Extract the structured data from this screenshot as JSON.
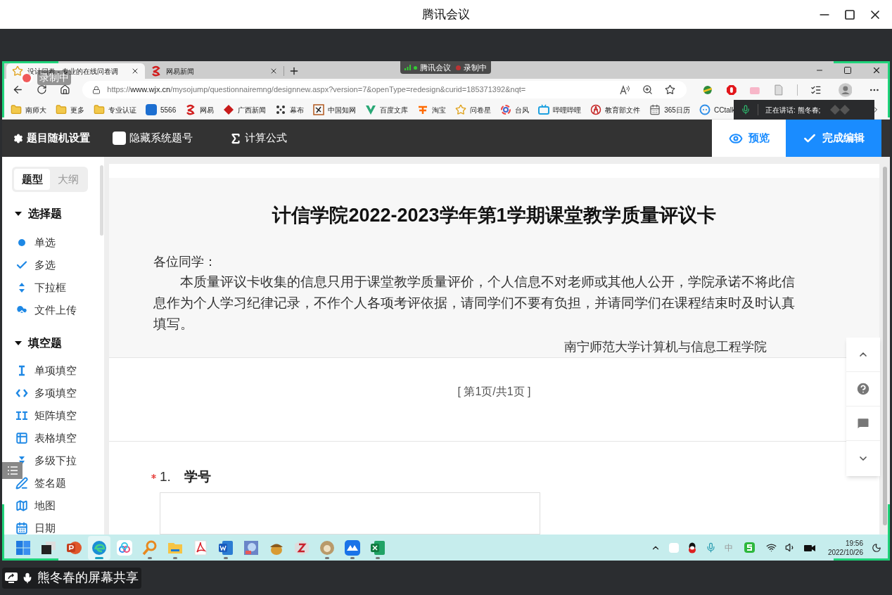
{
  "meeting": {
    "title": "腾讯会议",
    "pill_app": "腾讯会议",
    "pill_status": "录制中",
    "recording_badge": "录制中",
    "speaking": "正在讲话: 熊冬春;",
    "share_label": "熊冬春的屏幕共享"
  },
  "browser": {
    "tabs": [
      {
        "title": "设计问卷 - 专业的在线问卷调",
        "kind": "star",
        "selected": true
      },
      {
        "title": "网易新闻",
        "kind": "netease",
        "selected": false
      }
    ],
    "url_scheme": "https://",
    "url_host": "www.wjx.cn",
    "url_path": "/mysojump/questionnairemng/designnew.aspx?version=7&openType=redesign&curid=185371392&nqt=",
    "bookmarks": [
      {
        "label": "南师大",
        "kind": "folder"
      },
      {
        "label": "更多",
        "kind": "folder"
      },
      {
        "label": "专业认证",
        "kind": "folder"
      },
      {
        "label": "5566",
        "kind": "five"
      },
      {
        "label": "网易",
        "kind": "netease"
      },
      {
        "label": "广西新闻",
        "kind": "diamond"
      },
      {
        "label": "幕布",
        "kind": "dots"
      },
      {
        "label": "中国知网",
        "kind": "cnki"
      },
      {
        "label": "百度文库",
        "kind": "vee"
      },
      {
        "label": "淘宝",
        "kind": "taobao"
      },
      {
        "label": "问卷星",
        "kind": "star"
      },
      {
        "label": "台风",
        "kind": "swirl"
      },
      {
        "label": "哔哩哔哩",
        "kind": "tv"
      },
      {
        "label": "教育部文件",
        "kind": "emblem"
      },
      {
        "label": "365日历",
        "kind": "calendar"
      },
      {
        "label": "CCtalk",
        "kind": "cc"
      }
    ]
  },
  "toolbar": {
    "random": "题目随机设置",
    "hide_numbers": {
      "label": "隐藏系统题号",
      "checked": false
    },
    "formula": "计算公式",
    "preview": "预览",
    "done": "完成编辑"
  },
  "sidebar": {
    "tabs": [
      {
        "label": "题型",
        "selected": true
      },
      {
        "label": "大纲",
        "selected": false
      }
    ],
    "groups": [
      {
        "title": "选择题",
        "expanded": true,
        "items": [
          {
            "label": "单选",
            "kind": "radio"
          },
          {
            "label": "多选",
            "kind": "check"
          },
          {
            "label": "下拉框",
            "kind": "updown"
          },
          {
            "label": "文件上传",
            "kind": "upload"
          }
        ]
      },
      {
        "title": "填空题",
        "expanded": true,
        "items": [
          {
            "label": "单项填空",
            "kind": "cursor"
          },
          {
            "label": "多项填空",
            "kind": "braces"
          },
          {
            "label": "矩阵填空",
            "kind": "double-cursor"
          },
          {
            "label": "表格填空",
            "kind": "table"
          },
          {
            "label": "多级下拉",
            "kind": "cascade"
          },
          {
            "label": "签名题",
            "kind": "pen"
          },
          {
            "label": "地图",
            "kind": "map"
          },
          {
            "label": "日期",
            "kind": "date"
          }
        ]
      }
    ]
  },
  "survey": {
    "title": "计信学院2022-2023学年第1学期课堂教学质量评议卡",
    "greeting": "各位同学：",
    "body": "本质量评议卡收集的信息只用于课堂教学质量评价，个人信息不对老师或其他人公开，学院承诺不将此信息作为个人学习纪律记录，不作个人各项考评依据，请同学们不要有负担，并请同学们在课程结束时及时认真填写。",
    "signature": "南宁师范大学计算机与信息工程学院",
    "page_indicator": "[ 第1页/共1页 ]",
    "questions": [
      {
        "number": "1.",
        "title": "学号",
        "required": true
      }
    ]
  },
  "taskbar": {
    "apps": [
      {
        "kind": "start",
        "running": false,
        "selected": false
      },
      {
        "kind": "taskview",
        "running": false,
        "selected": false
      },
      {
        "kind": "slides",
        "running": false,
        "selected": false
      },
      {
        "kind": "edge",
        "running": true,
        "selected": true
      },
      {
        "kind": "cloud",
        "running": false,
        "selected": false
      },
      {
        "kind": "magnifier",
        "running": true,
        "selected": false
      },
      {
        "kind": "folder",
        "running": true,
        "selected": false
      },
      {
        "kind": "pdf",
        "running": false,
        "selected": false
      },
      {
        "kind": "word",
        "running": true,
        "selected": false
      },
      {
        "kind": "paint",
        "running": false,
        "selected": false
      },
      {
        "kind": "acorn",
        "running": false,
        "selected": false
      },
      {
        "kind": "zotero",
        "running": false,
        "selected": false
      },
      {
        "kind": "avatar",
        "running": true,
        "selected": false
      },
      {
        "kind": "mountains",
        "running": true,
        "selected": false
      },
      {
        "kind": "sheet",
        "running": true,
        "selected": false
      }
    ],
    "ime": "中",
    "time": "19:56",
    "date": "2022/10/26"
  }
}
